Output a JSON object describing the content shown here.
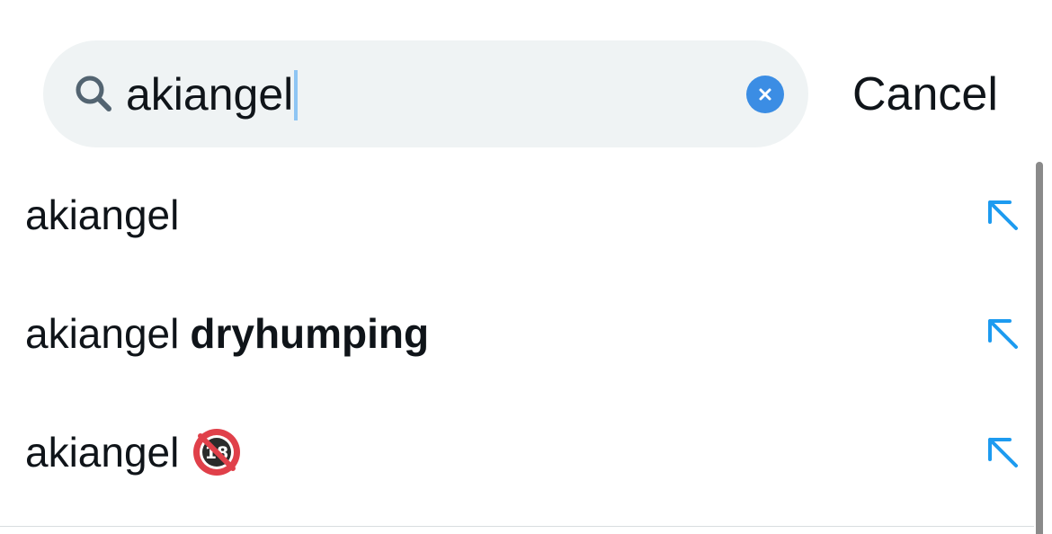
{
  "search": {
    "query": "akiangel",
    "icon": "search-icon",
    "clear_icon": "clear-icon"
  },
  "header": {
    "cancel_label": "Cancel"
  },
  "suggestions": [
    {
      "prefix": "akiangel",
      "bold": "",
      "emoji": "",
      "icon": "arrow-up-left-icon"
    },
    {
      "prefix": "akiangel",
      "bold": "dryhumping",
      "emoji": "",
      "icon": "arrow-up-left-icon"
    },
    {
      "prefix": "akiangel",
      "bold": "",
      "emoji": "no-one-under-eighteen-icon",
      "icon": "arrow-up-left-icon"
    }
  ],
  "colors": {
    "accent": "#1d9bf0",
    "search_background": "#eff3f4",
    "clear_button": "#3b8de4",
    "text": "#0f1419"
  }
}
